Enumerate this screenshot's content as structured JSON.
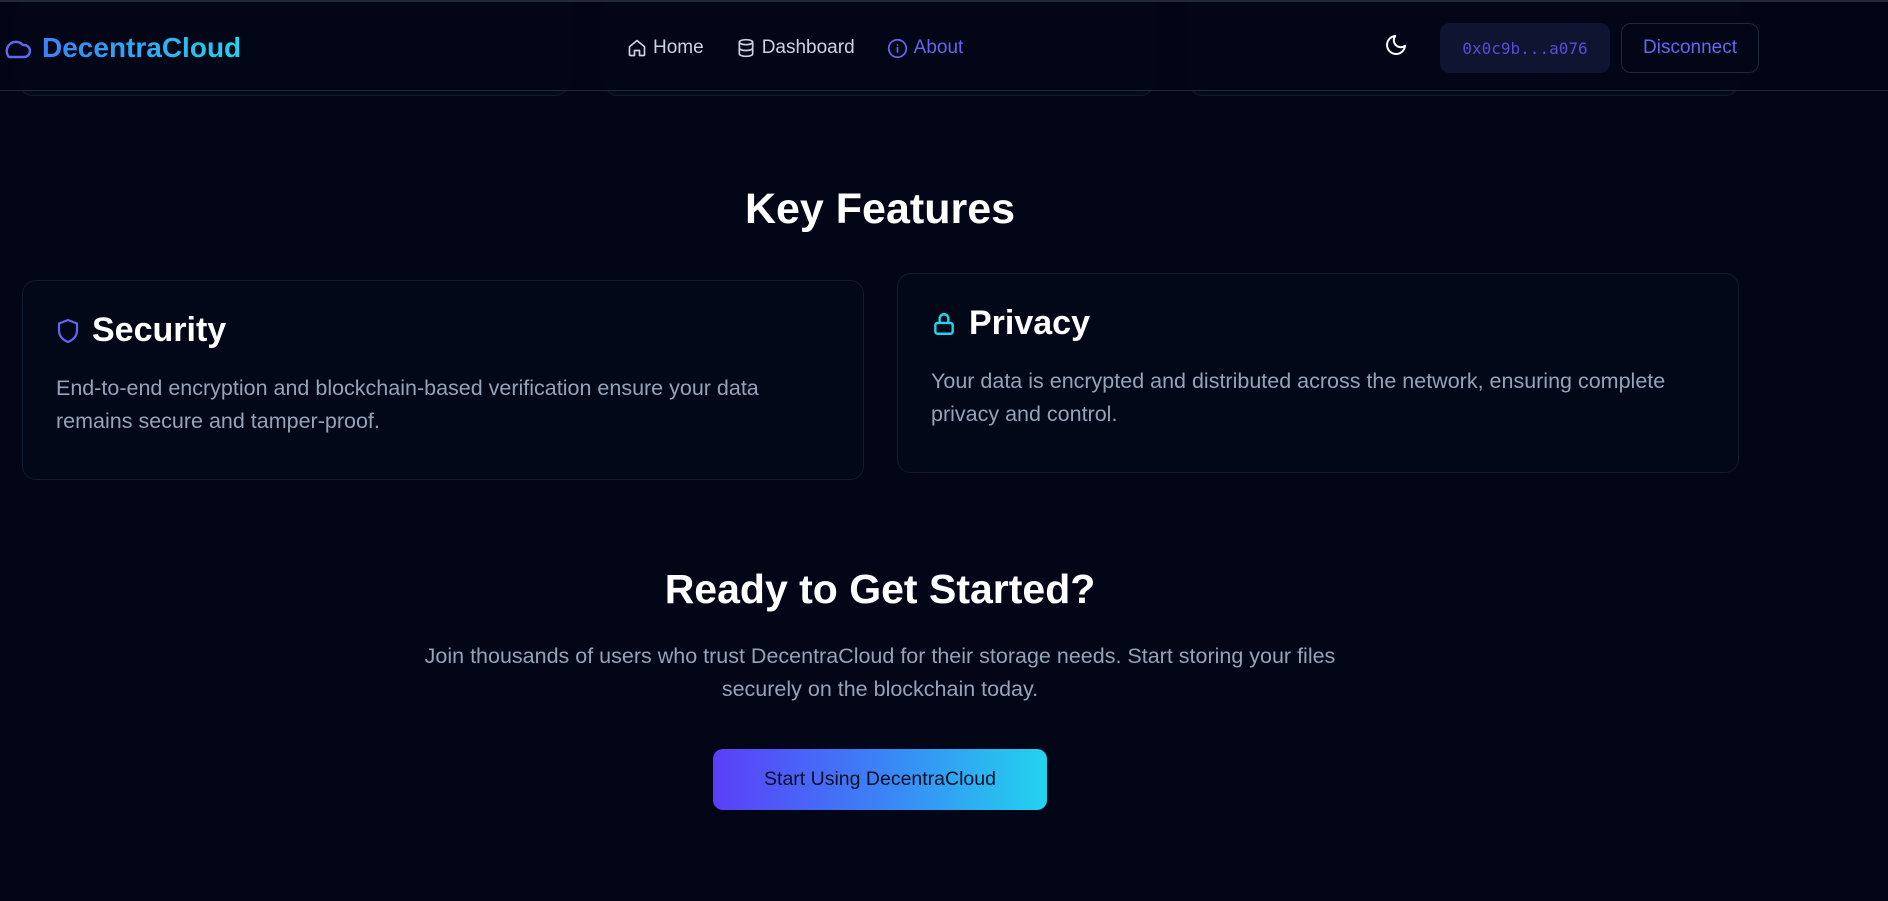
{
  "app": {
    "brand_name": "DecentraCloud",
    "brand_icon": "cloud-icon"
  },
  "header": {
    "nav": [
      {
        "label": "Home",
        "icon": "home-icon",
        "active": false
      },
      {
        "label": "Dashboard",
        "icon": "database-icon",
        "active": false
      },
      {
        "label": "About",
        "icon": "info-icon",
        "active": true
      }
    ],
    "theme_toggle_icon": "moon-icon",
    "wallet_address": "0x0c9b...a076",
    "disconnect_label": "Disconnect"
  },
  "features": {
    "heading": "Key Features",
    "cards": [
      {
        "title": "Security",
        "icon": "shield-icon",
        "description": "End-to-end encryption and blockchain-based verification ensure your data remains secure and tamper-proof."
      },
      {
        "title": "Privacy",
        "icon": "lock-icon",
        "description": "Your data is encrypted and distributed across the network, ensuring complete privacy and control."
      }
    ]
  },
  "cta": {
    "heading": "Ready to Get Started?",
    "description": "Join thousands of users who trust DecentraCloud for their storage needs. Start storing your files securely on the blockchain today.",
    "button_label": "Start Using DecentraCloud"
  },
  "colors": {
    "background": "#020617",
    "accent_indigo": "#6366f1",
    "accent_cyan": "#22d3ee",
    "muted_text": "#94a3b8"
  }
}
